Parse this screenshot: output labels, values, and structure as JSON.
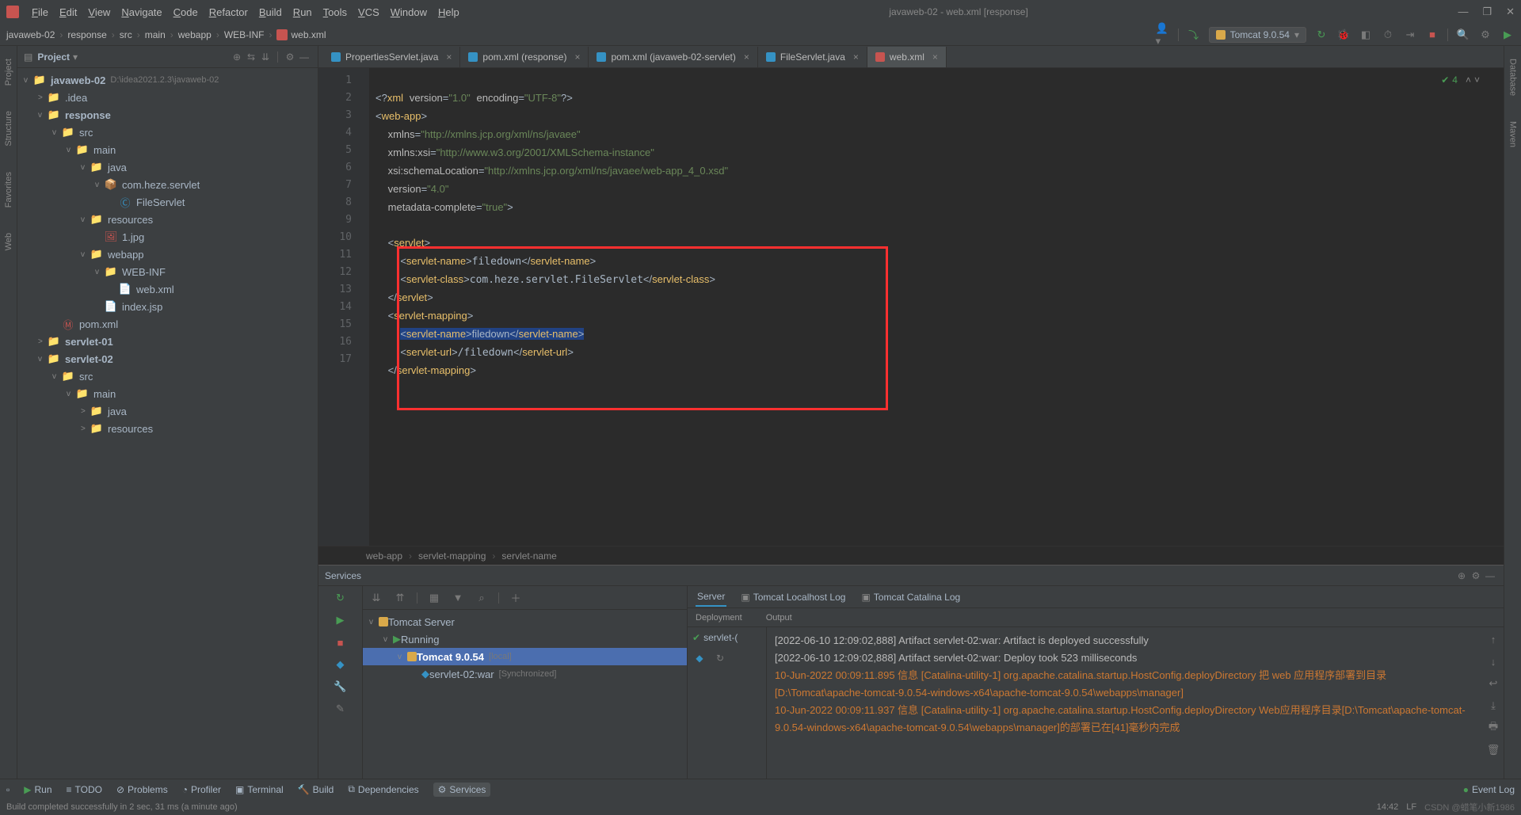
{
  "window": {
    "title": "javaweb-02 - web.xml [response]",
    "menus": [
      "File",
      "Edit",
      "View",
      "Navigate",
      "Code",
      "Refactor",
      "Build",
      "Run",
      "Tools",
      "VCS",
      "Window",
      "Help"
    ]
  },
  "breadcrumb": [
    "javaweb-02",
    "response",
    "src",
    "main",
    "webapp",
    "WEB-INF",
    "web.xml"
  ],
  "run_config": "Tomcat 9.0.54",
  "project": {
    "title": "Project",
    "root_name": "javaweb-02",
    "root_path": "D:\\idea2021.2.3\\javaweb-02",
    "tree": [
      {
        "indent": 1,
        "kind": "folder",
        "name": ".idea",
        "arrow": ">"
      },
      {
        "indent": 1,
        "kind": "module",
        "name": "response",
        "arrow": "v",
        "bold": true
      },
      {
        "indent": 2,
        "kind": "folder",
        "name": "src",
        "arrow": "v"
      },
      {
        "indent": 3,
        "kind": "folder",
        "name": "main",
        "arrow": "v"
      },
      {
        "indent": 4,
        "kind": "folder-src",
        "name": "java",
        "arrow": "v"
      },
      {
        "indent": 5,
        "kind": "package",
        "name": "com.heze.servlet",
        "arrow": "v"
      },
      {
        "indent": 6,
        "kind": "class",
        "name": "FileServlet",
        "arrow": ""
      },
      {
        "indent": 4,
        "kind": "folder-res",
        "name": "resources",
        "arrow": "v"
      },
      {
        "indent": 5,
        "kind": "file-img",
        "name": "1.jpg",
        "arrow": ""
      },
      {
        "indent": 4,
        "kind": "folder",
        "name": "webapp",
        "arrow": "v"
      },
      {
        "indent": 5,
        "kind": "folder",
        "name": "WEB-INF",
        "arrow": "v"
      },
      {
        "indent": 6,
        "kind": "file-xml",
        "name": "web.xml",
        "arrow": ""
      },
      {
        "indent": 5,
        "kind": "file-jsp",
        "name": "index.jsp",
        "arrow": ""
      },
      {
        "indent": 2,
        "kind": "file-m",
        "name": "pom.xml",
        "arrow": ""
      },
      {
        "indent": 1,
        "kind": "module",
        "name": "servlet-01",
        "arrow": ">",
        "bold": true
      },
      {
        "indent": 1,
        "kind": "module",
        "name": "servlet-02",
        "arrow": "v",
        "bold": true
      },
      {
        "indent": 2,
        "kind": "folder",
        "name": "src",
        "arrow": "v"
      },
      {
        "indent": 3,
        "kind": "folder",
        "name": "main",
        "arrow": "v"
      },
      {
        "indent": 4,
        "kind": "folder-src",
        "name": "java",
        "arrow": ">"
      },
      {
        "indent": 4,
        "kind": "folder-res",
        "name": "resources",
        "arrow": ">"
      }
    ]
  },
  "tabs": [
    {
      "label": "PropertiesServlet.java",
      "icon": "ti-blue"
    },
    {
      "label": "pom.xml (response)",
      "icon": "ti-m"
    },
    {
      "label": "pom.xml (javaweb-02-servlet)",
      "icon": "ti-m"
    },
    {
      "label": "FileServlet.java",
      "icon": "ti-blue"
    },
    {
      "label": "web.xml",
      "icon": "ti-x",
      "active": true
    }
  ],
  "editor": {
    "lines": [
      1,
      2,
      3,
      4,
      5,
      6,
      7,
      8,
      9,
      10,
      11,
      12,
      13,
      14,
      15,
      16,
      17
    ],
    "inspections": "4"
  },
  "code_breadcrumb": [
    "web-app",
    "servlet-mapping",
    "servlet-name"
  ],
  "services": {
    "title": "Services",
    "tabs": [
      "Server",
      "Tomcat Localhost Log",
      "Tomcat Catalina Log"
    ],
    "subhead": [
      "Deployment",
      "Output"
    ],
    "tree": [
      {
        "indent": 0,
        "label": "Tomcat Server",
        "icon": "tomcat",
        "arrow": "v"
      },
      {
        "indent": 1,
        "label": "Running",
        "icon": "run",
        "arrow": "v"
      },
      {
        "indent": 2,
        "label": "Tomcat 9.0.54",
        "suffix": "[local]",
        "icon": "tomcat",
        "arrow": "v",
        "sel": true
      },
      {
        "indent": 3,
        "label": "servlet-02:war",
        "suffix": "[Synchronized]",
        "icon": "artifact",
        "arrow": ""
      }
    ],
    "deployment_item": "servlet-(",
    "console": [
      {
        "cls": "info",
        "text": "[2022-06-10 12:09:02,888] Artifact servlet-02:war: Artifact is deployed successfully"
      },
      {
        "cls": "info",
        "text": "[2022-06-10 12:09:02,888] Artifact servlet-02:war: Deploy took 523 milliseconds"
      },
      {
        "cls": "warn",
        "text": "10-Jun-2022 00:09:11.895 信息 [Catalina-utility-1] org.apache.catalina.startup.HostConfig.deployDirectory 把 web 应用程序部署到目录 [D:\\Tomcat\\apache-tomcat-9.0.54-windows-x64\\apache-tomcat-9.0.54\\webapps\\manager]"
      },
      {
        "cls": "warn",
        "text": "10-Jun-2022 00:09:11.937 信息 [Catalina-utility-1] org.apache.catalina.startup.HostConfig.deployDirectory Web应用程序目录[D:\\Tomcat\\apache-tomcat-9.0.54-windows-x64\\apache-tomcat-9.0.54\\webapps\\manager]的部署已在[41]毫秒内完成"
      }
    ]
  },
  "bottom_bar": [
    "Run",
    "TODO",
    "Problems",
    "Profiler",
    "Terminal",
    "Build",
    "Dependencies",
    "Services"
  ],
  "event_log": "Event Log",
  "status": {
    "msg": "Build completed successfully in 2 sec, 31 ms (a minute ago)",
    "time": "14:42",
    "enc": "LF",
    "watermark": "CSDN @蜡笔小新1986"
  },
  "left_tabs": [
    "Project",
    "Structure",
    "Favorites",
    "Web"
  ],
  "right_tabs": [
    "Database",
    "Maven"
  ]
}
